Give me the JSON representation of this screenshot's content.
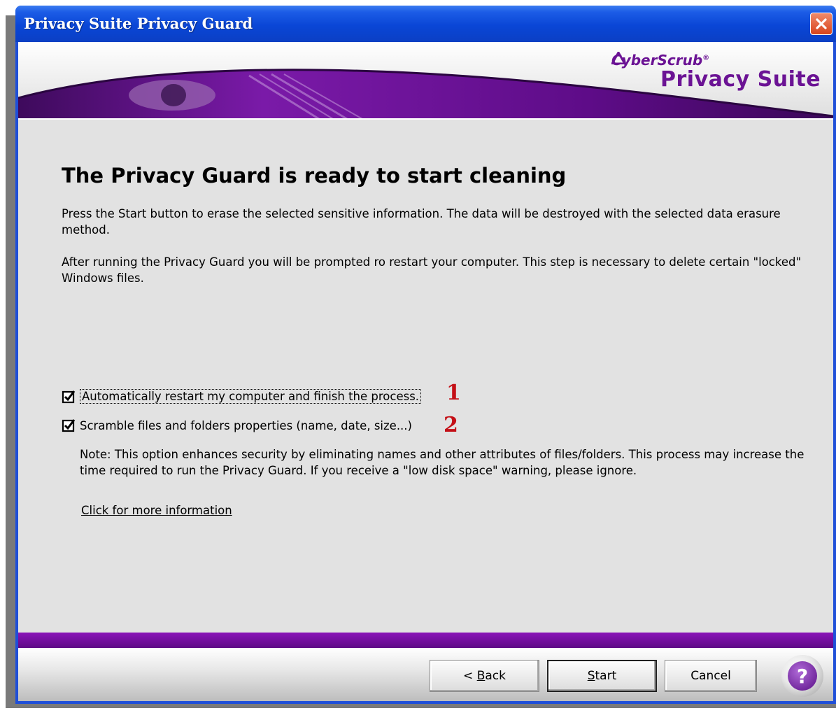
{
  "window": {
    "title": "Privacy Suite Privacy Guard"
  },
  "banner": {
    "brand_small": "CyberScrub",
    "brand_large": "Privacy Suite"
  },
  "content": {
    "heading": "The Privacy Guard is ready to start cleaning",
    "paragraph1": "Press the Start button to erase the selected sensitive information. The data will be destroyed with the selected data erasure method.",
    "paragraph2": "After running the Privacy Guard you will be prompted ro restart your computer. This step is necessary to delete certain \"locked\" Windows files.",
    "option1": {
      "label": "Automatically restart my computer and finish the process.",
      "checked": true,
      "marker": "1"
    },
    "option2": {
      "label": "Scramble files and folders properties (name, date, size...)",
      "checked": true,
      "marker": "2"
    },
    "note": "Note: This option enhances security by eliminating names and other attributes of files/folders. This process may increase the time required to run the Privacy Guard. If you receive a \"low disk space\" warning, please ignore.",
    "more_info_link": "Click for more information"
  },
  "buttons": {
    "back_prefix": "< ",
    "back_mnemonic": "B",
    "back_rest": "ack",
    "start_mnemonic": "S",
    "start_rest": "tart",
    "cancel": "Cancel",
    "help": "?"
  },
  "colors": {
    "accent_purple": "#6b1394",
    "titlebar_blue": "#0a46d6",
    "marker_red": "#c40f16"
  }
}
